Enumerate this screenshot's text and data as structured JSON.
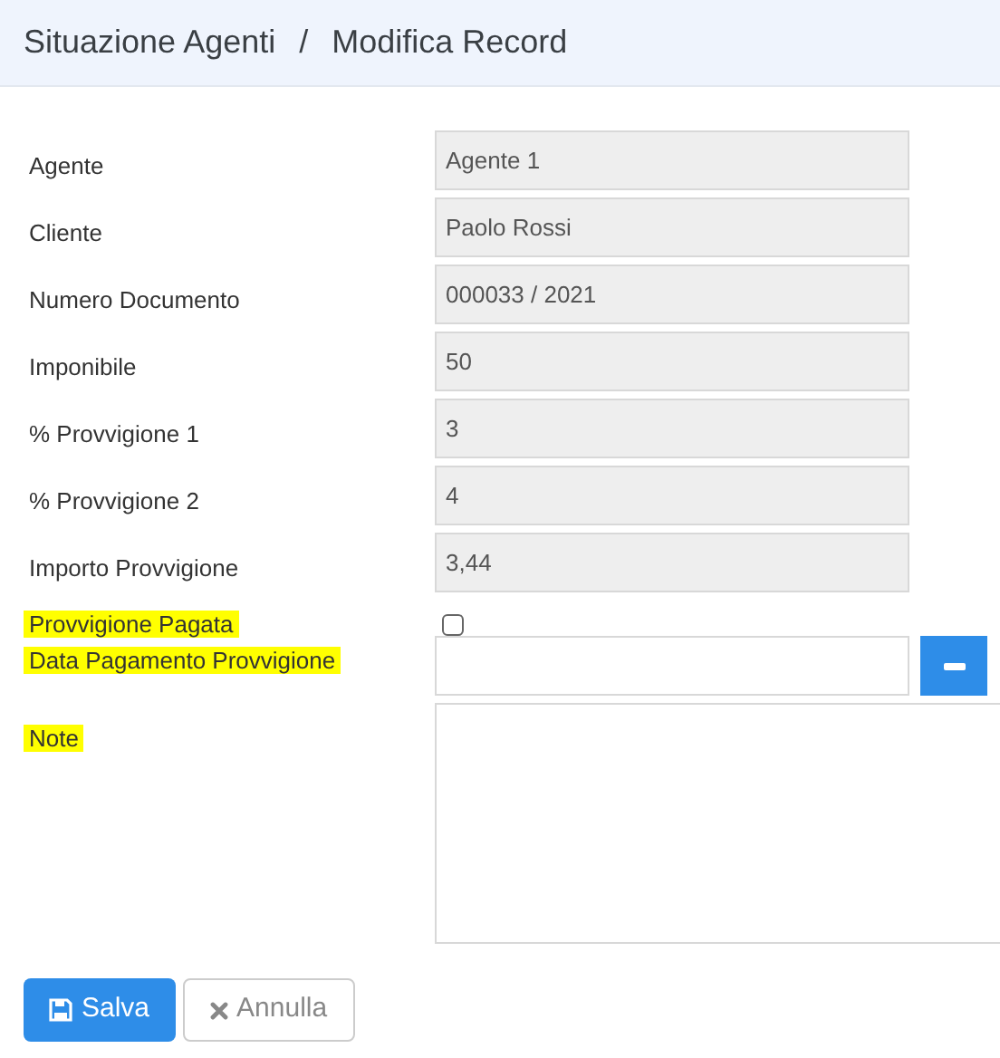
{
  "breadcrumb": {
    "parent": "Situazione Agenti",
    "separator": "/",
    "current": "Modifica Record"
  },
  "fields": [
    {
      "kind": "readonly",
      "label": "Agente",
      "value": "Agente 1",
      "highlighted": false
    },
    {
      "kind": "readonly",
      "label": "Cliente",
      "value": "Paolo Rossi",
      "highlighted": false
    },
    {
      "kind": "readonly",
      "label": "Numero Documento",
      "value": "000033 / 2021",
      "highlighted": false
    },
    {
      "kind": "readonly",
      "label": "Imponibile",
      "value": "50",
      "highlighted": false
    },
    {
      "kind": "readonly",
      "label": "% Provvigione 1",
      "value": "3",
      "highlighted": false
    },
    {
      "kind": "readonly",
      "label": "% Provvigione 2",
      "value": "4",
      "highlighted": false
    },
    {
      "kind": "readonly",
      "label": "Importo Provvigione",
      "value": "3,44",
      "highlighted": false
    },
    {
      "kind": "checkbox",
      "label": "Provvigione Pagata",
      "checked": false,
      "highlighted": true
    },
    {
      "kind": "date",
      "label": "Data Pagamento Provvigione",
      "highlighted": true
    },
    {
      "kind": "textarea",
      "label": "Note",
      "highlighted": true
    }
  ],
  "buttons": [
    {
      "kind": "primary",
      "label": "Salva"
    },
    {
      "kind": "secondary",
      "label": "Annulla"
    }
  ]
}
